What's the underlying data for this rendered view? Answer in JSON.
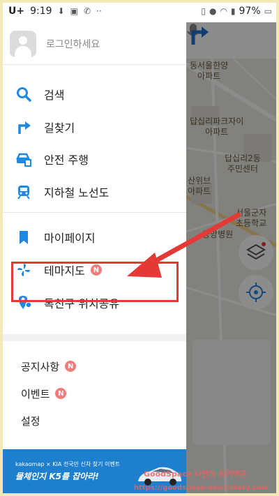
{
  "status_bar": {
    "carrier": "U+",
    "time": "9:19",
    "more": "··",
    "battery": "97%"
  },
  "drawer": {
    "login_prompt": "로그인하세요",
    "menu": [
      {
        "label": "검색",
        "icon": "search-icon"
      },
      {
        "label": "길찾기",
        "icon": "directions-icon"
      },
      {
        "label": "안전 주행",
        "icon": "safe-drive-icon"
      },
      {
        "label": "지하철 노선도",
        "icon": "subway-icon"
      },
      {
        "label": "마이페이지",
        "icon": "bookmark-icon"
      },
      {
        "label": "테마지도",
        "icon": "pinwheel-icon",
        "badge": "N"
      },
      {
        "label": "톡친구 위치공유",
        "icon": "location-share-icon"
      }
    ],
    "sub_menu": [
      {
        "label": "공지사항",
        "badge": "N"
      },
      {
        "label": "이벤트",
        "badge": "N"
      },
      {
        "label": "설정"
      }
    ],
    "banner": {
      "brand_line": "kakaomap × KIA  전국민 신차 찾기 이벤트",
      "headline": "물체인지 K5를 잡아라!"
    }
  },
  "map": {
    "labels": [
      "동서울한양\n아파트",
      "답십리파크자이\n아파트",
      "답십리2동\n주민센터",
      "산위브\n아파트",
      "서울군자\n초등학교",
      "아파트",
      "중앙병원"
    ]
  },
  "watermark": {
    "line1": "GoodSpace 나만의 위키백과",
    "line2": "https://goodspace-dev.tistory.com"
  },
  "colors": {
    "accent": "#1e88e5",
    "badge": "#f07c7c",
    "highlight": "#e53935",
    "banner": "#1f7fcf"
  }
}
